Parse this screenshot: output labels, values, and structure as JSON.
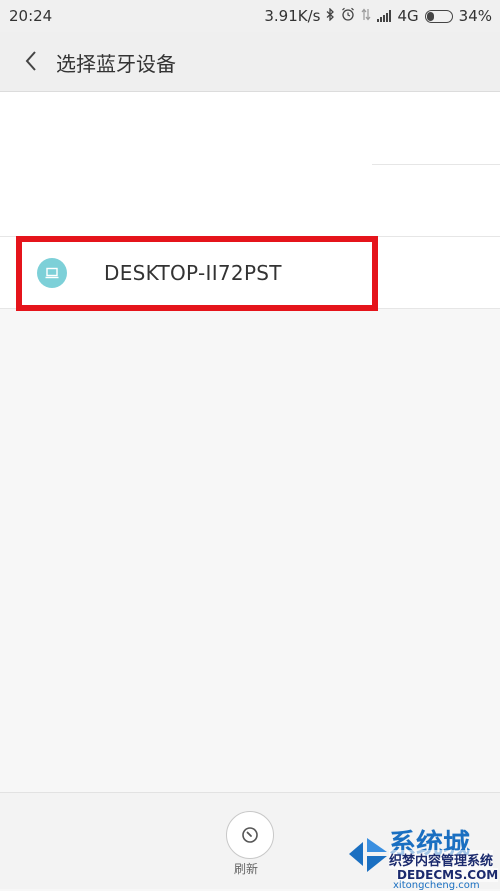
{
  "status_bar": {
    "time": "20:24",
    "speed": "3.91K/s",
    "network": "4G",
    "battery": "34%",
    "battery_level": 0.34,
    "icons": [
      "bluetooth-icon",
      "alarm-icon",
      "data-transfer-icon",
      "signal-icon",
      "battery-icon"
    ]
  },
  "header": {
    "title": "选择蓝牙设备",
    "back_icon": "chevron-left-icon"
  },
  "devices": [
    {
      "name": "DESKTOP-II72PST",
      "icon": "laptop-icon"
    }
  ],
  "bottom_bar": {
    "refresh_label": "刷新",
    "refresh_icon": "refresh-icon"
  },
  "watermark": {
    "title": "系统城",
    "subtitle": "xitongcheng.com",
    "cms_text": "织梦内容管理系统",
    "cms_url": "DEDECMS.COM"
  },
  "colors": {
    "highlight": "#e5141b",
    "device_icon_bg": "#7dd0d8",
    "watermark_blue": "#1a6fc1"
  }
}
